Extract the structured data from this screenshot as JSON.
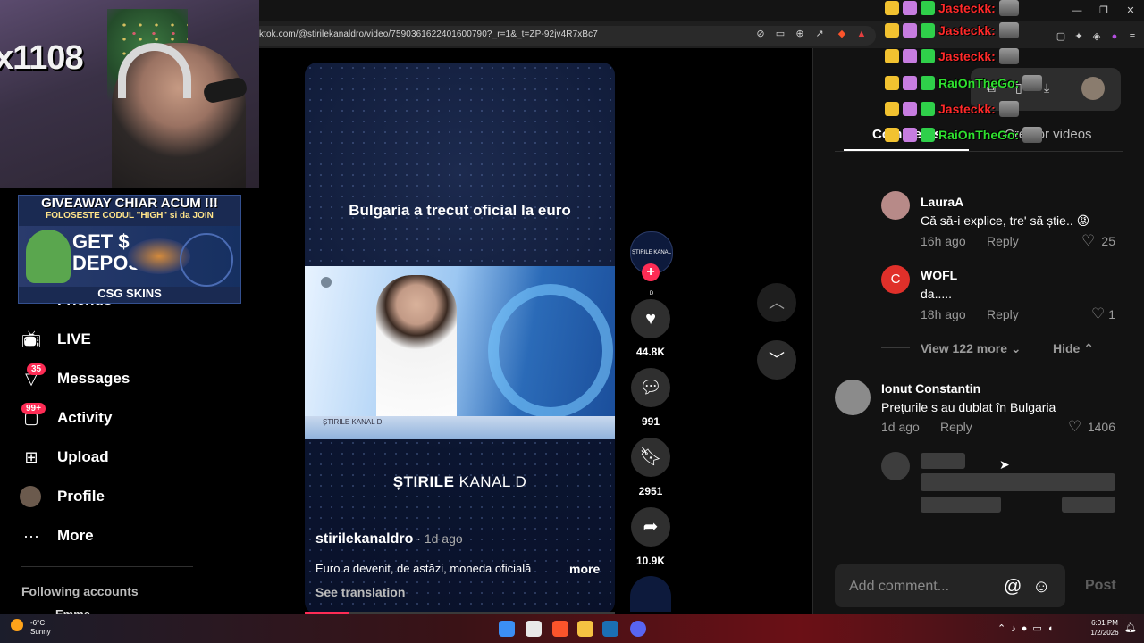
{
  "browser": {
    "url": "ktok.com/@stirilekanaldro/video/7590361622401600790?_r=1&_t=ZP-92jv4R7xBc7",
    "toolbar_icons": [
      "mute-tab-icon",
      "cast-icon",
      "zoom-icon",
      "share-icon",
      "brave-shield-icon",
      "brave-rewards-icon"
    ],
    "window_icons": [
      "minimize-icon",
      "restore-icon",
      "close-icon"
    ]
  },
  "stream_overlay": {
    "cam_text": "x1108",
    "ad": {
      "line1": "GIVEAWAY CHIAR ACUM !!!",
      "line2": "FOLOSESTE CODUL \"HIGH\" si da JOIN",
      "line3": "GET $ DEPOS",
      "brand": "CSG SKINS"
    },
    "chat": [
      {
        "name": "Jasteckk:",
        "color": "#ff2a2a"
      },
      {
        "name": "Jasteckk:",
        "color": "#ff2a2a"
      },
      {
        "name": "Jasteckk:",
        "color": "#ff2a2a"
      },
      {
        "name": "RaiOnTheGo:",
        "color": "#2fe02f"
      },
      {
        "name": "Jasteckk:",
        "color": "#ff2a2a"
      },
      {
        "name": "RaiOnTheGo:",
        "color": "#2fe02f"
      }
    ]
  },
  "sidebar": {
    "items": [
      {
        "label": "LIVE",
        "icon": "live-tv-icon"
      },
      {
        "label": "Messages",
        "icon": "messages-icon",
        "badge": "35"
      },
      {
        "label": "Activity",
        "icon": "activity-icon",
        "badge": "99+"
      },
      {
        "label": "Upload",
        "icon": "upload-icon"
      },
      {
        "label": "Profile",
        "icon": "profile-avatar-icon"
      },
      {
        "label": "More",
        "icon": "more-dots-icon"
      }
    ],
    "partial_friends": "Friends",
    "following_heading": "Following accounts",
    "partial_following": "Emme"
  },
  "video": {
    "headline": "Bulgaria a trecut oficial la euro",
    "channel_logo_bold": "ȘTIRILE",
    "channel_logo_rest": " KANAL D",
    "author": "stirilekanaldro",
    "age": " · 1d ago",
    "description": "Euro a devenit, de astăzi, moneda oficială",
    "more": "more",
    "see_translation": "See translation",
    "frame_logo": "ȘTIRILE KANAL D",
    "avatar_text": "ȘTIRILE KANAL D",
    "progress": 0.14
  },
  "actions": {
    "likes": "44.8K",
    "comments": "991",
    "saves": "2951",
    "shares": "10.9K"
  },
  "comments_panel": {
    "tab_comments": "Comments",
    "tab_creator": "Creator videos",
    "comments": [
      {
        "name": "LauraA",
        "text": "Că să-i explice, tre' să știe.. 😡",
        "time": "16h ago",
        "reply": "Reply",
        "likes": "25",
        "avatar_color": "#b78a88"
      },
      {
        "name": "WOFL",
        "text": "da.....",
        "time": "18h ago",
        "reply": "Reply",
        "likes": "1",
        "avatar_color": "#e0302a",
        "avatar_letter": "C"
      },
      {
        "name": "Ionut Constantin",
        "text": "Prețurile s au dublat în Bulgaria",
        "time": "1d ago",
        "reply": "Reply",
        "likes": "1406",
        "avatar_color": "#8b8b8b"
      }
    ],
    "view_more": "View 122 more",
    "hide": "Hide",
    "add_placeholder": "Add comment...",
    "post": "Post"
  },
  "taskbar": {
    "temp": "-6°C",
    "weather": "Sunny",
    "time": "6:01 PM",
    "date": "1/2/2026"
  }
}
